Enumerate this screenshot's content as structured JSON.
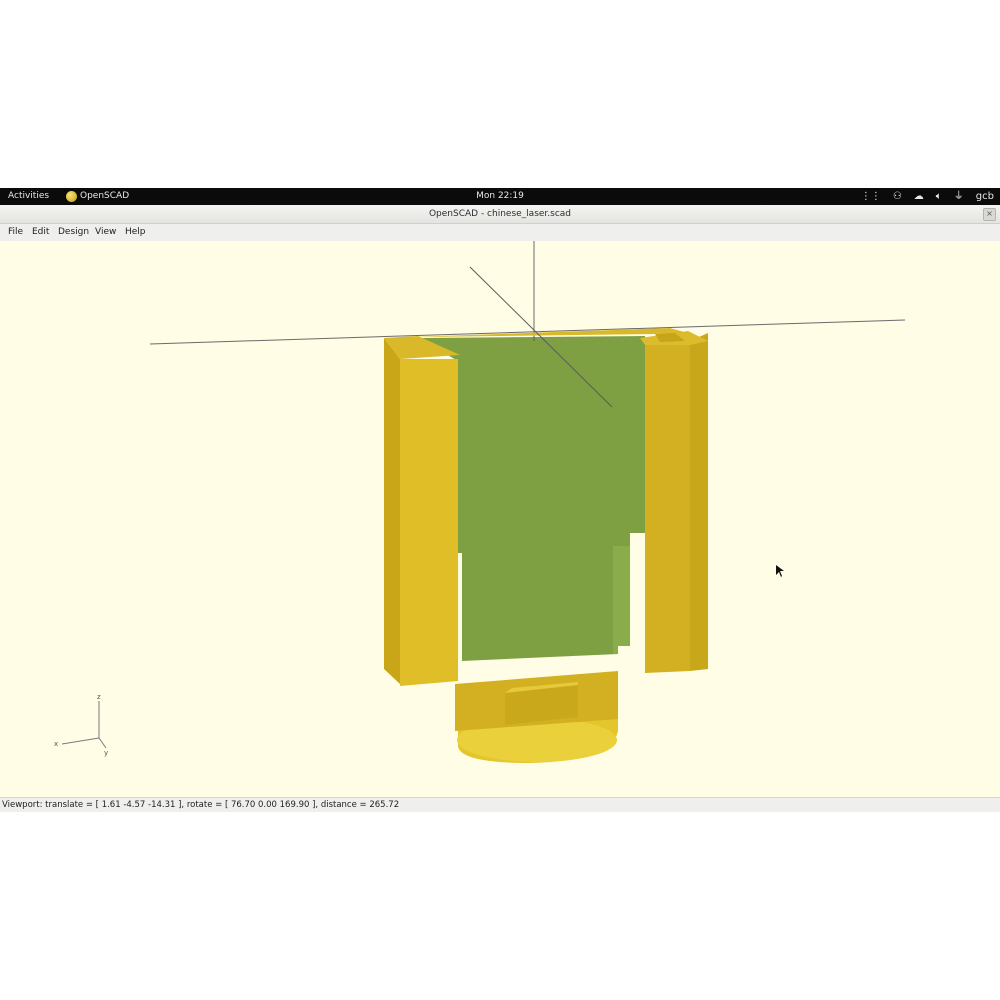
{
  "topbar": {
    "activities": "Activities",
    "app_name": "OpenSCAD",
    "clock": "Mon 22:19",
    "user": "gcb",
    "tray_icons": [
      "grid-icon",
      "accessibility-icon",
      "chat-icon",
      "volume-icon",
      "network-icon"
    ]
  },
  "window": {
    "title": "OpenSCAD - chinese_laser.scad",
    "close_glyph": "×"
  },
  "menu": {
    "file": "File",
    "edit": "Edit",
    "design": "Design",
    "view": "View",
    "help": "Help"
  },
  "axes_gizmo": {
    "z": "z",
    "x": "x",
    "y": "y"
  },
  "status": {
    "viewport": "Viewport: translate = [ 1.61 -4.57 -14.31 ], rotate = [ 76.70 0.00 169.90 ], distance = 265.72"
  },
  "colors": {
    "viewport_bg": "#fffde5",
    "model_yellow": "#e8c931",
    "model_green": "#7ea043"
  }
}
